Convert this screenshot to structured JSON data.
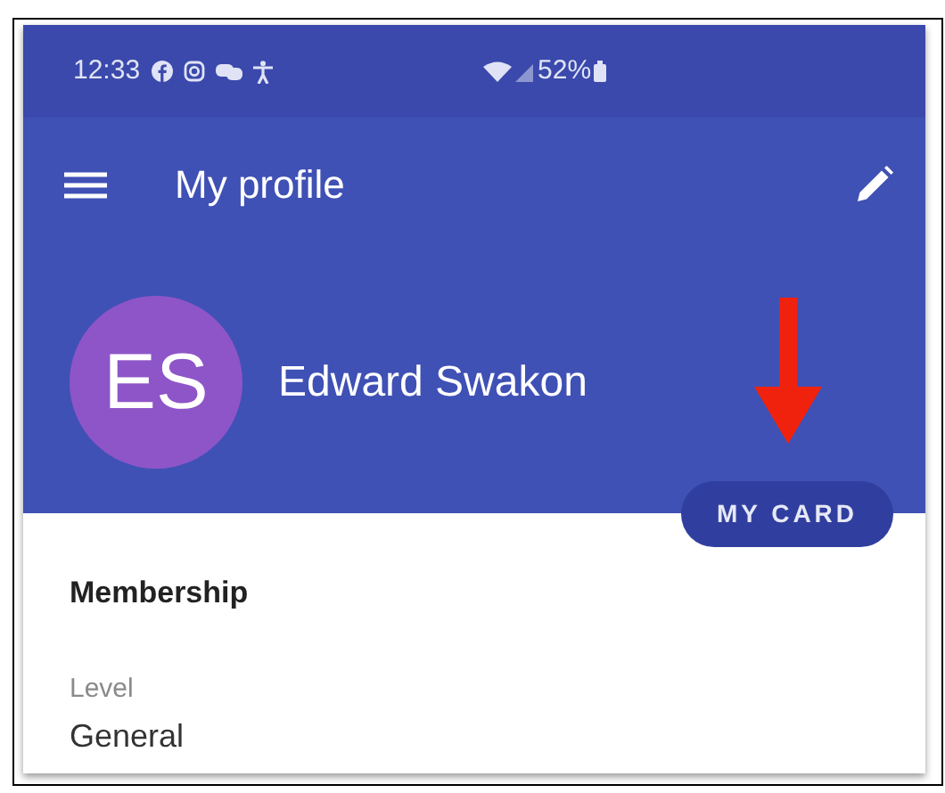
{
  "status_bar": {
    "time": "12:33",
    "battery": "52%"
  },
  "toolbar": {
    "title": "My profile"
  },
  "profile": {
    "initials": "ES",
    "name": "Edward Swakon",
    "card_button": "MY CARD"
  },
  "membership": {
    "heading": "Membership",
    "fields": [
      {
        "label": "Level",
        "value": "General"
      }
    ]
  }
}
